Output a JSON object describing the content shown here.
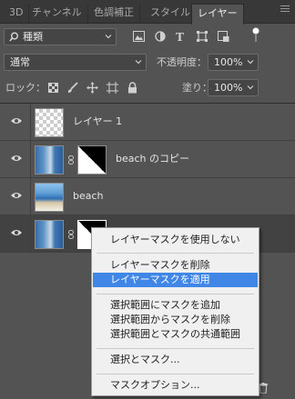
{
  "tabs": [
    "3D",
    "チャンネル",
    "色調補正",
    "スタイル",
    "レイヤー"
  ],
  "active_tab": 4,
  "filter": {
    "kind_label": "種類",
    "kind_icon": "search-icon"
  },
  "filter_icons": [
    "image-filter-icon",
    "adjustment-filter-icon",
    "type-filter-icon",
    "shape-filter-icon",
    "smart-object-filter-icon",
    "filter-toggle-icon"
  ],
  "blend": {
    "mode": "通常",
    "opacity_label": "不透明度：",
    "opacity_value": "100%"
  },
  "lock": {
    "label": "ロック：",
    "fill_label": "塗り：",
    "fill_value": "100%",
    "icons": [
      "lock-transparent-icon",
      "lock-paint-icon",
      "lock-position-icon",
      "lock-artboard-icon",
      "lock-all-icon"
    ]
  },
  "layers": [
    {
      "name": "レイヤー 1",
      "thumb": "transparent",
      "mask": false,
      "selected": false
    },
    {
      "name": "beach のコピー",
      "thumb": "beach",
      "mask": true,
      "selected": false
    },
    {
      "name": "beach",
      "thumb": "beach",
      "mask": false,
      "selected": false
    },
    {
      "name": "",
      "thumb": "beach",
      "mask": true,
      "selected": true
    }
  ],
  "context_menu": {
    "items": [
      {
        "label": "レイヤーマスクを使用しない",
        "highlighted": false
      },
      {
        "label": "レイヤーマスクを削除",
        "highlighted": false
      },
      {
        "label": "レイヤーマスクを適用",
        "highlighted": true
      },
      {
        "label": "選択範囲にマスクを追加",
        "highlighted": false
      },
      {
        "label": "選択範囲からマスクを削除",
        "highlighted": false
      },
      {
        "label": "選択範囲とマスクの共通範囲",
        "highlighted": false
      },
      {
        "label": "選択とマスク...",
        "highlighted": false
      },
      {
        "label": "マスクオプション...",
        "highlighted": false
      }
    ]
  },
  "colors": {
    "panel": "#535353",
    "tabbar": "#383838",
    "highlight": "#3f86e6",
    "menu_bg": "#f0f0f0"
  }
}
